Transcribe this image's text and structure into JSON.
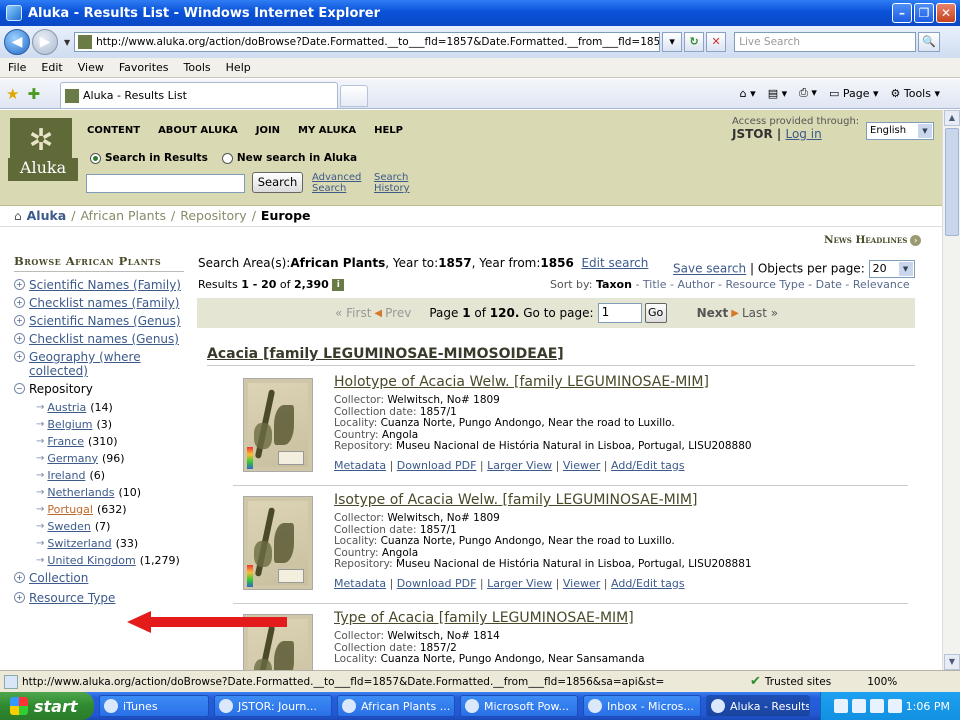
{
  "window": {
    "title": "Aluka - Results List - Windows Internet Explorer"
  },
  "addressbar": {
    "url": "http://www.aluka.org/action/doBrowse?Date.Formatted.__to___fld=1857&Date.Formatted.__from___fld=1856&sa=api&st=",
    "search_placeholder": "Live Search"
  },
  "menubar": [
    "File",
    "Edit",
    "View",
    "Favorites",
    "Tools",
    "Help"
  ],
  "tabbar": {
    "tab_title": "Aluka - Results List",
    "page_label": "Page",
    "tools_label": "Tools"
  },
  "header": {
    "logo_text": "Aluka",
    "nav": [
      "CONTENT",
      "ABOUT ALUKA",
      "JOIN",
      "MY ALUKA",
      "HELP"
    ],
    "access_text": "Access provided through:",
    "access_org": "JSTOR",
    "login": "Log in",
    "language": "English",
    "radio_in_results": "Search in Results",
    "radio_new_search": "New search in Aluka",
    "search_button": "Search",
    "advanced_1": "Advanced",
    "advanced_2": "Search",
    "history_1": "Search",
    "history_2": "History"
  },
  "breadcrumb": {
    "home": "Aluka",
    "level1": "African Plants",
    "level2": "Repository",
    "current": "Europe",
    "sep": "/"
  },
  "sidebar": {
    "heading": "Browse African Plants",
    "items": [
      "Scientific Names (Family)",
      "Checklist names (Family)",
      "Scientific Names (Genus)",
      "Checklist names (Genus)",
      "Geography (where collected)"
    ],
    "repository": "Repository",
    "countries": [
      {
        "name": "Austria",
        "count": "(14)"
      },
      {
        "name": "Belgium",
        "count": "(3)"
      },
      {
        "name": "France",
        "count": "(310)"
      },
      {
        "name": "Germany",
        "count": "(96)"
      },
      {
        "name": "Ireland",
        "count": "(6)"
      },
      {
        "name": "Netherlands",
        "count": "(10)"
      },
      {
        "name": "Portugal",
        "count": "(632)"
      },
      {
        "name": "Sweden",
        "count": "(7)"
      },
      {
        "name": "Switzerland",
        "count": "(33)"
      },
      {
        "name": "United Kingdom",
        "count": "(1,279)"
      }
    ],
    "collection": "Collection",
    "resource_type": "Resource Type"
  },
  "main": {
    "news_headlines": "News Headlines",
    "search_area_prefix": "Search Area(s):",
    "search_area_value": "African Plants",
    "year_to_label": ", Year to:",
    "year_to": "1857",
    "year_from_label": ", Year from:",
    "year_from": "1856",
    "edit_search": "Edit search",
    "save_search": "Save search",
    "objects_per_page_label": "| Objects per page:",
    "objects_per_page": "20",
    "results_prefix": "Results",
    "results_range": "1 - 20",
    "results_of": "of",
    "results_total": "2,390",
    "info_icon": "i",
    "sort_by_label": "Sort by:",
    "sort_active": "Taxon",
    "sort_options": "- Title - Author - Resource Type - Date - Relevance",
    "pager": {
      "first": "« First",
      "prev": "Prev",
      "page_label": "Page",
      "page_current": "1",
      "page_of": "of",
      "page_total": "120.",
      "goto_label": "Go to page:",
      "goto_value": "1",
      "go": "Go",
      "next": "Next",
      "last": "Last »"
    },
    "family_header": "Acacia [family LEGUMINOSAE-MIMOSOIDEAE]"
  },
  "records": [
    {
      "title": "Holotype of Acacia Welw. [family LEGUMINOSAE-MIM]",
      "collector": "Welwitsch, No# 1809",
      "date": "1857/1",
      "locality": "Cuanza Norte, Pungo Andongo, Near the road to Luxillo.",
      "country": "Angola",
      "repository": "Museu Nacional de História Natural in Lisboa, Portugal, LISU208880"
    },
    {
      "title": "Isotype of Acacia Welw. [family LEGUMINOSAE-MIM]",
      "collector": "Welwitsch, No# 1809",
      "date": "1857/1",
      "locality": "Cuanza Norte, Pungo Andongo, Near the road to Luxillo.",
      "country": "Angola",
      "repository": "Museu Nacional de História Natural in Lisboa, Portugal, LISU208881"
    },
    {
      "title": "Type of Acacia [family LEGUMINOSAE-MIM]",
      "collector": "Welwitsch, No# 1814",
      "date": "1857/2",
      "locality": "Cuanza Norte, Pungo Andongo, Near Sansamanda",
      "country": "",
      "repository": ""
    }
  ],
  "record_labels": {
    "collector": "Collector:",
    "date": "Collection date:",
    "locality": "Locality:",
    "country": "Country:",
    "repository": "Repository:",
    "metadata": "Metadata",
    "download_pdf": "Download PDF",
    "larger_view": "Larger View",
    "viewer": "Viewer",
    "add_tags": "Add/Edit tags"
  },
  "statusbar": {
    "url": "http://www.aluka.org/action/doBrowse?Date.Formatted.__to___fld=1857&Date.Formatted.__from___fld=1856&sa=api&st=",
    "zone": "Trusted sites",
    "zoom": "100%"
  },
  "taskbar": {
    "start": "start",
    "items": [
      "iTunes",
      "JSTOR: Journ...",
      "African Plants ...",
      "Microsoft Pow...",
      "Inbox - Micros...",
      "Aluka - Results..."
    ],
    "clock": "1:06 PM"
  },
  "colors": {
    "header_bg": "#d9d9b4",
    "logo_bg": "#5f6a38",
    "link": "#3c5a8a",
    "annotation_arrow": "#e41b1b"
  }
}
